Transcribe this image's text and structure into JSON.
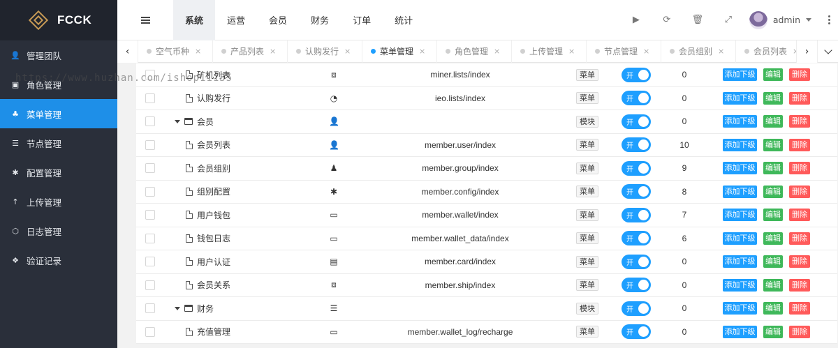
{
  "brand": {
    "name": "FCCK"
  },
  "sidebar": {
    "items": [
      {
        "label": "管理团队",
        "icon": "user-icon",
        "glyph": "👤",
        "active": false
      },
      {
        "label": "角色管理",
        "icon": "id-card-icon",
        "glyph": "▣",
        "active": false
      },
      {
        "label": "菜单管理",
        "icon": "tree-icon",
        "glyph": "♣",
        "active": true
      },
      {
        "label": "节点管理",
        "icon": "list-icon",
        "glyph": "☰",
        "active": false
      },
      {
        "label": "配置管理",
        "icon": "asterisk-icon",
        "glyph": "✱",
        "active": false
      },
      {
        "label": "上传管理",
        "icon": "arrow-up-icon",
        "glyph": "↑",
        "active": false
      },
      {
        "label": "日志管理",
        "icon": "hexagon-icon",
        "glyph": "⬡",
        "active": false
      },
      {
        "label": "验证记录",
        "icon": "cubes-icon",
        "glyph": "❖",
        "active": false
      }
    ]
  },
  "header": {
    "tabs": [
      {
        "label": "系统",
        "active": true
      },
      {
        "label": "运营",
        "active": false
      },
      {
        "label": "会员",
        "active": false
      },
      {
        "label": "财务",
        "active": false
      },
      {
        "label": "订单",
        "active": false
      },
      {
        "label": "统计",
        "active": false
      }
    ],
    "tools": [
      {
        "name": "play-icon",
        "glyph": "▶"
      },
      {
        "name": "refresh-icon",
        "glyph": "⟳"
      },
      {
        "name": "trash-icon",
        "glyph": "🗑"
      },
      {
        "name": "fullscreen-icon",
        "glyph": "⤢"
      }
    ],
    "user": {
      "name": "admin"
    }
  },
  "page_tabs": {
    "left_arrow": "‹",
    "right_arrow": "›",
    "close": "×",
    "items": [
      {
        "label": "空气币种",
        "active": false
      },
      {
        "label": "产品列表",
        "active": false
      },
      {
        "label": "认购发行",
        "active": false
      },
      {
        "label": "菜单管理",
        "active": true
      },
      {
        "label": "角色管理",
        "active": false
      },
      {
        "label": "上传管理",
        "active": false
      },
      {
        "label": "节点管理",
        "active": false
      },
      {
        "label": "会员组别",
        "active": false
      },
      {
        "label": "会员列表",
        "active": false
      }
    ]
  },
  "table": {
    "switch_label": "开",
    "add_label": "添加下级",
    "edit_label": "编辑",
    "del_label": "删除",
    "rows": [
      {
        "title": "矿机列表",
        "level": "child",
        "icon": "cubes-icon",
        "glyph": "⧈",
        "href": "miner.lists/index",
        "type": "菜单",
        "sort": "0"
      },
      {
        "title": "认购发行",
        "level": "child",
        "icon": "pie-chart-icon",
        "glyph": "◔",
        "href": "ieo.lists/index",
        "type": "菜单",
        "sort": "0"
      },
      {
        "title": "会员",
        "level": "parent",
        "icon": "user-icon",
        "glyph": "👤",
        "href": "",
        "type": "模块",
        "sort": "0"
      },
      {
        "title": "会员列表",
        "level": "child",
        "icon": "user-icon",
        "glyph": "👤",
        "href": "member.user/index",
        "type": "菜单",
        "sort": "10"
      },
      {
        "title": "会员组别",
        "level": "child",
        "icon": "user-secret-icon",
        "glyph": "♟",
        "href": "member.group/index",
        "type": "菜单",
        "sort": "9"
      },
      {
        "title": "组别配置",
        "level": "child",
        "icon": "asterisk-icon",
        "glyph": "✱",
        "href": "member.config/index",
        "type": "菜单",
        "sort": "8"
      },
      {
        "title": "用户钱包",
        "level": "child",
        "icon": "money-icon",
        "glyph": "▭",
        "href": "member.wallet/index",
        "type": "菜单",
        "sort": "7"
      },
      {
        "title": "钱包日志",
        "level": "child",
        "icon": "money-icon",
        "glyph": "▭",
        "href": "member.wallet_data/index",
        "type": "菜单",
        "sort": "6"
      },
      {
        "title": "用户认证",
        "level": "child",
        "icon": "id-card-icon",
        "glyph": "▤",
        "href": "member.card/index",
        "type": "菜单",
        "sort": "0"
      },
      {
        "title": "会员关系",
        "level": "child",
        "icon": "cubes-icon",
        "glyph": "⧈",
        "href": "member.ship/index",
        "type": "菜单",
        "sort": "0"
      },
      {
        "title": "财务",
        "level": "parent",
        "icon": "list-icon",
        "glyph": "☰",
        "href": "",
        "type": "模块",
        "sort": "0"
      },
      {
        "title": "充值管理",
        "level": "child",
        "icon": "money-icon",
        "glyph": "▭",
        "href": "member.wallet_log/recharge",
        "type": "菜单",
        "sort": "0"
      }
    ]
  },
  "watermark": "https://www.huzhan.com/ishop11135",
  "colors": {
    "accent": "#1e9fff",
    "sidebar_bg": "#2a2f3a",
    "edit": "#3fb85a",
    "delete": "#ff5a5a"
  }
}
